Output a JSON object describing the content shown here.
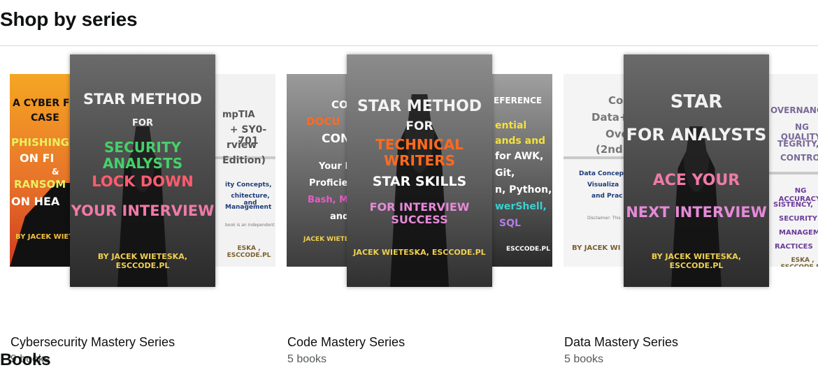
{
  "headings": {
    "shop_by_series": "Shop by series",
    "books": "Books"
  },
  "series": [
    {
      "title": "Cybersecurity Mastery Series",
      "count": "9 books",
      "back_left": {
        "lines": [
          "A CYBER F",
          "CASE",
          "PHISHING",
          "ON FI",
          "&",
          "RANSOM",
          "ON HEA",
          "BY JACEK WIETE"
        ]
      },
      "front": {
        "lines": [
          "STAR METHOD",
          "FOR",
          "SECURITY ANALYSTS",
          "LOCK DOWN",
          "YOUR INTERVIEW",
          "BY JACEK WIETESKA, ESCCODE.PL"
        ]
      },
      "back_right": {
        "lines": [
          "mpTIA",
          "+ SY0-701",
          "rview",
          "Edition)",
          "ity Concepts,",
          "chitecture, and",
          "Management",
          "book is an independent",
          "ESKA , ESCCODE.PL"
        ]
      }
    },
    {
      "title": "Code Mastery Series",
      "count": "5 books",
      "back_left": {
        "lines": [
          "CO",
          "DOCU",
          "CONT",
          "Your P",
          "Proficie",
          "Bash, Ma",
          "and",
          "JACEK WIETES"
        ]
      },
      "front": {
        "lines": [
          "STAR METHOD",
          "FOR",
          "TECHNICAL WRITERS",
          "STAR SKILLS",
          "FOR INTERVIEW SUCCESS",
          "JACEK WIETESKA, ESCCODE.PL"
        ]
      },
      "back_right": {
        "lines": [
          "EFERENCE",
          "ential",
          "ands and",
          "for AWK,",
          "Git,",
          "n, Python,",
          "werShell,",
          "SQL",
          "ESCCODE.PL"
        ]
      }
    },
    {
      "title": "Data Mastery Series",
      "count": "5 books",
      "back_left": {
        "lines": [
          "Co",
          "Data+",
          "Ove",
          "(2nd",
          "Data Concepts",
          "Visualiza",
          "and Prac",
          "Disclaimer: This",
          "BY JACEK WI"
        ]
      },
      "front": {
        "lines": [
          "STAR",
          "FOR ANALYSTS",
          "ACE YOUR",
          "NEXT INTERVIEW",
          "BY JACEK WIETESKA, ESCCODE.PL"
        ]
      },
      "back_right": {
        "lines": [
          "OVERNANCE:",
          "NG QUALITY,",
          "TEGRITY,",
          "CONTROL",
          "NG ACCURACY,",
          "SISTENCY,",
          "SECURITY",
          "MANAGEMENT",
          "RACTICES",
          "ESKA , ESCCODE.PL"
        ]
      }
    }
  ]
}
